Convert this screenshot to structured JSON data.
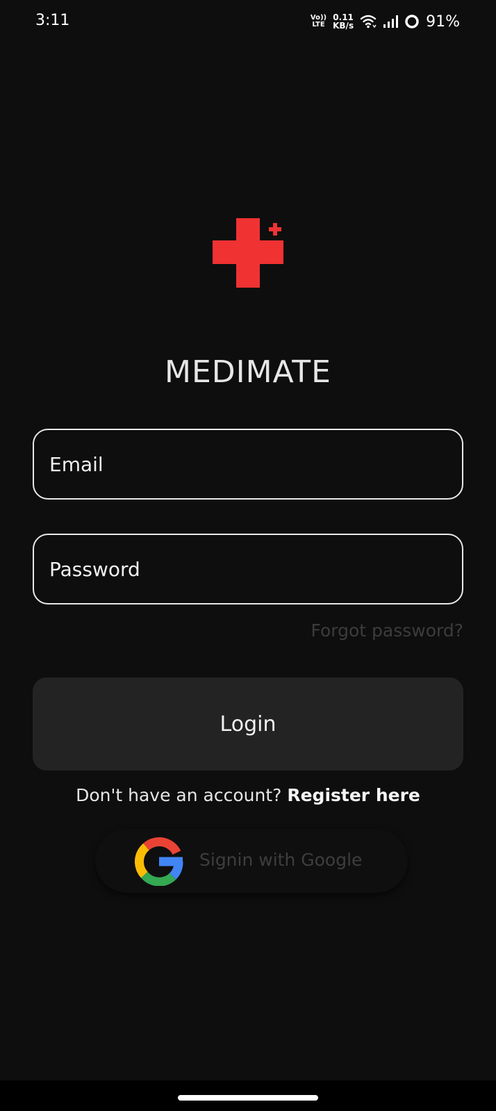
{
  "status_bar": {
    "time": "3:11",
    "volte_top": "Vo))",
    "volte_bottom": "LTE",
    "speed_value": "0.11",
    "speed_unit": "KB/s",
    "battery": "91%"
  },
  "app": {
    "title": "MEDIMATE",
    "accent_color": "#f03232"
  },
  "form": {
    "email_placeholder": "Email",
    "email_value": "",
    "password_placeholder": "Password",
    "password_value": "",
    "forgot_password": "Forgot password?",
    "login_label": "Login"
  },
  "register": {
    "prompt": "Don't have an account? ",
    "link": "Register here"
  },
  "google": {
    "label": "Signin with Google"
  },
  "icons": {
    "logo": "medical-cross-icon",
    "google": "google-g-icon",
    "wifi": "wifi-icon",
    "signal": "signal-bars-icon",
    "battery": "battery-ring-icon"
  }
}
